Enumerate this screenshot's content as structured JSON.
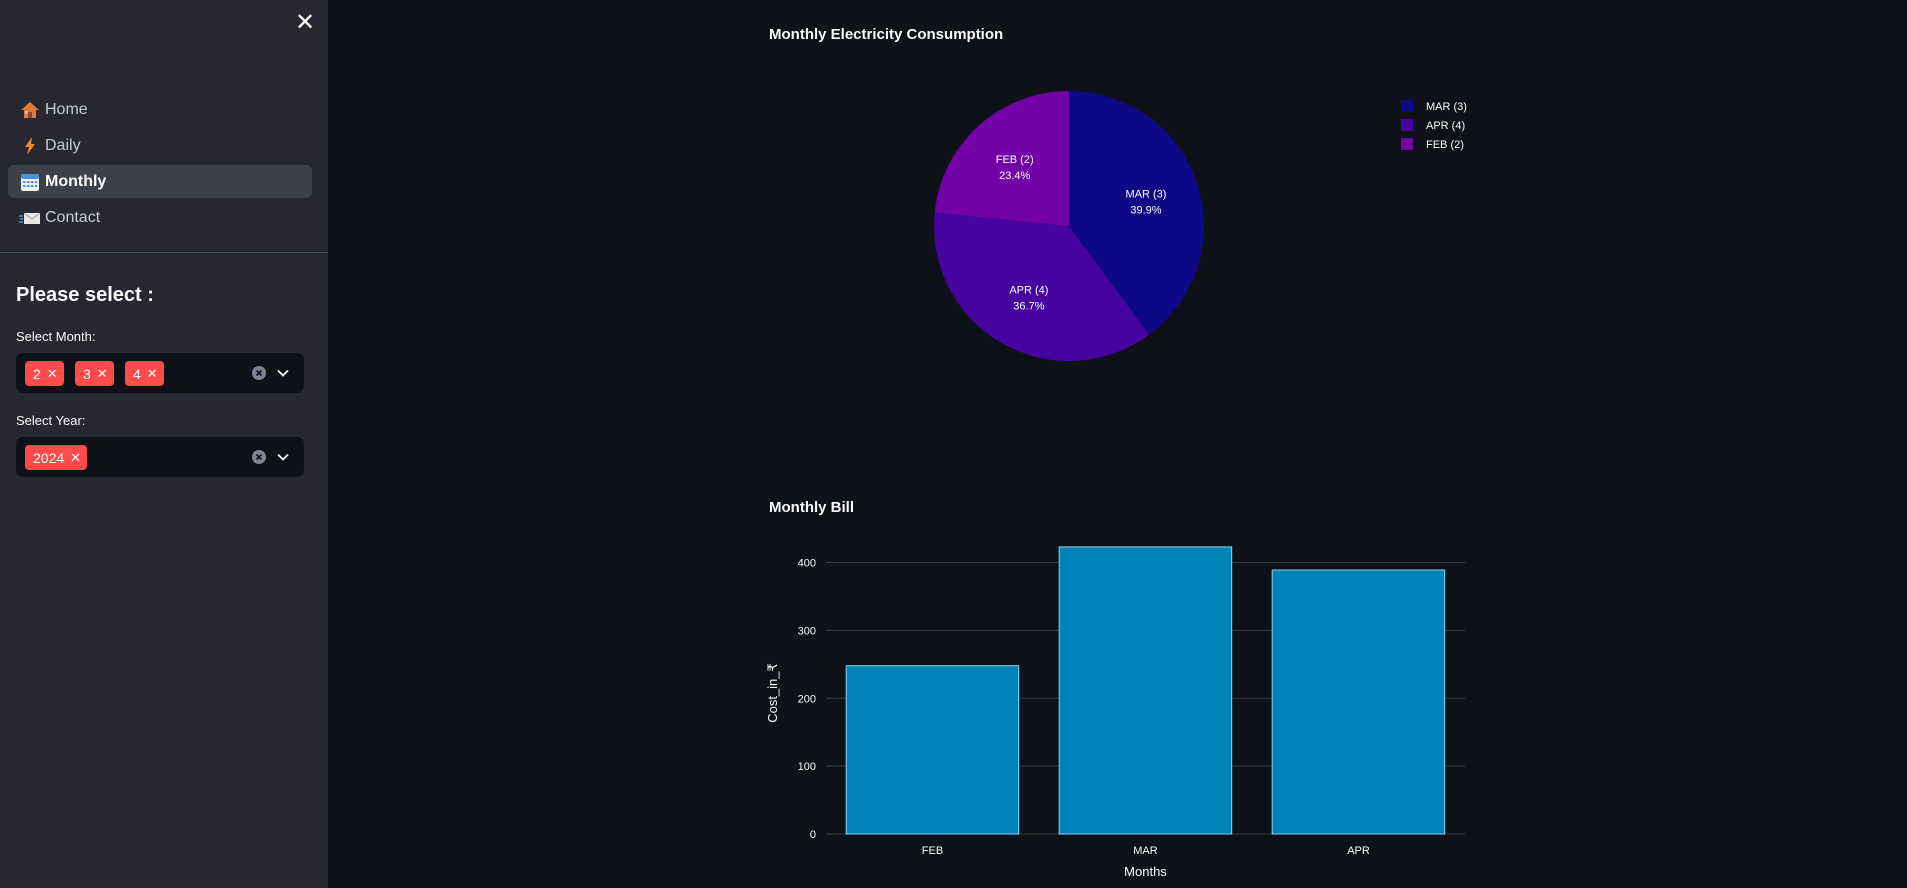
{
  "sidebar": {
    "close_icon": "close-icon",
    "nav": [
      {
        "label": "Home",
        "icon": "house-icon"
      },
      {
        "label": "Daily",
        "icon": "lightning-icon"
      },
      {
        "label": "Monthly",
        "icon": "calendar-icon",
        "active": true
      },
      {
        "label": "Contact",
        "icon": "envelope-icon"
      }
    ],
    "filters": {
      "title": "Please select :",
      "month": {
        "label": "Select Month:",
        "selected": [
          "2",
          "3",
          "4"
        ]
      },
      "year": {
        "label": "Select Year:",
        "selected": [
          "2024"
        ]
      }
    }
  },
  "colors": {
    "accent": "#ff4b4b",
    "bar": "#0083b8",
    "bg": "#0e1117",
    "sidebar": "#262730"
  },
  "chart_data": [
    {
      "type": "pie",
      "title": "Monthly Electricity Consumption",
      "slices": [
        {
          "label": "MAR (3)",
          "value": 39.9,
          "display": "39.9%",
          "color": "#0d0887"
        },
        {
          "label": "APR (4)",
          "value": 36.7,
          "display": "36.7%",
          "color": "#46039f"
        },
        {
          "label": "FEB (2)",
          "value": 23.4,
          "display": "23.4%",
          "color": "#7201a8"
        }
      ],
      "legend": [
        "MAR (3)",
        "APR (4)",
        "FEB (2)"
      ],
      "legend_position": "top-right"
    },
    {
      "type": "bar",
      "title": "Monthly Bill",
      "categories": [
        "FEB",
        "MAR",
        "APR"
      ],
      "values": [
        248,
        423,
        389
      ],
      "xlabel": "Months",
      "ylabel": "Cost_in_₹",
      "ylim": [
        0,
        445
      ],
      "yticks": [
        0,
        100,
        200,
        300,
        400
      ],
      "grid": true
    }
  ]
}
